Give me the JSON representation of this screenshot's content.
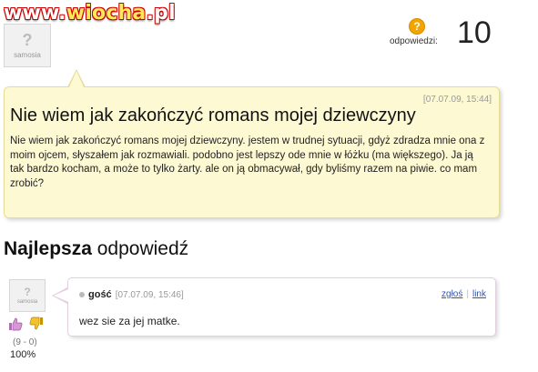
{
  "watermark": {
    "prefix": "www.",
    "highlight": "wiocha",
    "suffix": ".pl"
  },
  "header": {
    "avatar_logo": "samosia",
    "answers_label": "odpowiedzi:",
    "answers_count": "10"
  },
  "question": {
    "date": "[07.07.09, 15:44]",
    "title": "Nie wiem jak zakończyć romans mojej dziewczyny",
    "body": "Nie wiem jak zakończyć romans mojej dziewczyny. jestem w trudnej sytuacji, gdyż zdradza mnie ona z moim ojcem, słyszałem jak rozmawiali. podobno jest lepszy ode mnie w łóżku (ma większego). Ja ją tak bardzo kocham, a może to tylko żarty. ale on ją obmacywał, gdy byliśmy razem na piwie. co mam zrobić?"
  },
  "best_answer": {
    "heading_bold": "Najlepsza",
    "heading_rest": " odpowiedź",
    "avatar_logo": "samosia",
    "votes": "(9 - 0)",
    "percent": "100%",
    "author": "gość",
    "date": "[07.07.09, 15:46]",
    "report_label": "zgłoś",
    "link_label": "link",
    "text": "wez sie za jej matke."
  },
  "icons": {
    "thumb_up": "thumb-up-icon",
    "thumb_down": "thumb-down-icon",
    "question_badge": "question-icon"
  },
  "colors": {
    "bubble_bg": "#fdf9d2",
    "badge": "#f2a500",
    "link": "#3355aa"
  }
}
